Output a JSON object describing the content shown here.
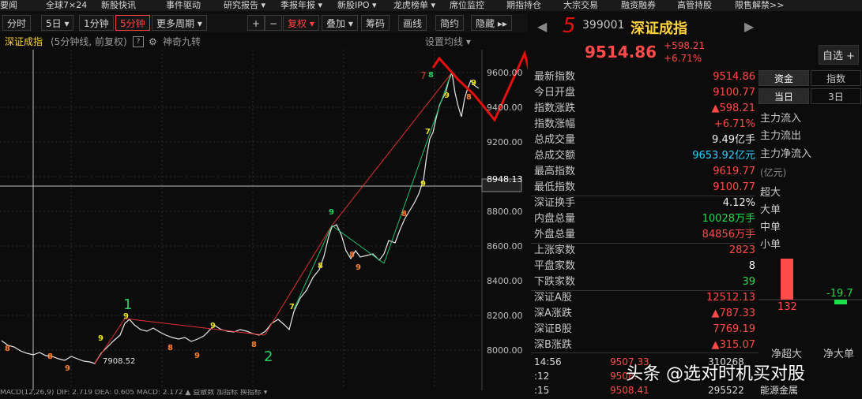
{
  "topbar": [
    "要闻",
    "全球7×24",
    "新股快讯",
    "事件驱动",
    "研究报告 ▾",
    "季报年报 ▾",
    "新股IPO ▾",
    "龙虎榜单 ▾",
    "席位监控",
    "期指持仓",
    "大宗交易",
    "融资融券",
    "高管持股",
    "限售解禁>>"
  ],
  "toolbar": {
    "periods": [
      "分时",
      "5日 ▾",
      "1分钟",
      "5分钟",
      "更多周期 ▾"
    ],
    "plus": "+",
    "minus": "−",
    "fuquan": "复权 ▾",
    "diejia": "叠加 ▾",
    "chouma": "筹码",
    "huaxian": "画线",
    "jianyue": "简约",
    "yincang": "隐藏 ▸▸"
  },
  "subbar": {
    "name": "深证成指",
    "desc": "(5分钟线, 前复权)",
    "question": "?",
    "indicator": "神奇九转",
    "setting": "设置均线 ▾"
  },
  "header": {
    "code": "399001",
    "name": "深证成指",
    "price": "9514.86",
    "change": "+598.21",
    "pct": "+6.71%",
    "zixuan": "自选 +"
  },
  "stats": [
    {
      "k": "最新指数",
      "v": "9514.86",
      "c": "red"
    },
    {
      "k": "今日开盘",
      "v": "9100.77",
      "c": "red"
    },
    {
      "k": "指数涨跌",
      "v": "▲598.21",
      "c": "red"
    },
    {
      "k": "指数涨幅",
      "v": "+6.71%",
      "c": "red"
    },
    {
      "k": "总成交量",
      "v": "9.49亿手",
      "c": "white"
    },
    {
      "k": "总成交额",
      "v": "9653.92亿元",
      "c": "cyan"
    },
    {
      "k": "最高指数",
      "v": "9619.77",
      "c": "red"
    },
    {
      "k": "最低指数",
      "v": "9100.77",
      "c": "red"
    },
    {
      "k": "深证换手",
      "v": "4.12%",
      "c": "white"
    },
    {
      "k": "内盘总量",
      "v": "10028万手",
      "c": "green"
    },
    {
      "k": "外盘总量",
      "v": "84856万手",
      "c": "red"
    },
    {
      "k": "上涨家数",
      "v": "2823",
      "c": "red"
    },
    {
      "k": "平盘家数",
      "v": "8",
      "c": "white"
    },
    {
      "k": "下跌家数",
      "v": "39",
      "c": "green"
    },
    {
      "k": "深证A股",
      "v": "12512.13",
      "c": "red"
    },
    {
      "k": "深A涨跌",
      "v": "▲787.33",
      "c": "red"
    },
    {
      "k": "深证B股",
      "v": "7769.19",
      "c": "red"
    },
    {
      "k": "深B涨跌",
      "v": "▲315.07",
      "c": "red"
    }
  ],
  "flow": {
    "tabs1": [
      "资金",
      "指数"
    ],
    "tabs2": [
      "当日",
      "3日"
    ],
    "items": [
      "主力流入",
      "主力流出",
      "主力净流入"
    ],
    "unit": "(亿元)",
    "sizes": [
      "超大",
      "大单",
      "中单",
      "小单"
    ],
    "bar1": {
      "label": "净超大",
      "value": "132"
    },
    "bar2": {
      "label": "净大单",
      "value": "-19.7"
    },
    "footer": "能源金属"
  },
  "ticks": [
    {
      "time": "14:56",
      "price": "9507.33",
      "vol": "310268"
    },
    {
      "time": ":12",
      "price": "9508.",
      "vol": ""
    },
    {
      "time": ":15",
      "price": "9508.41",
      "vol": "295522"
    }
  ],
  "yaxis": [
    "9600.00",
    "9400.00",
    "9200.00",
    "8948.13",
    "8800.00",
    "8600.00",
    "8400.00",
    "8200.00",
    "8000.00"
  ],
  "annotations": {
    "low": "7908.52",
    "a1": "1",
    "a2": "2",
    "a5": "5",
    "a7": "7"
  },
  "bottom": "MACD(12,26,9)  DIF: 2.719  DEA: 0.605  MACD: 2.172 ▲          益散数  加指标  换指标 ▾",
  "watermark": "头条 @选对时机买对股",
  "chart_data": {
    "type": "line",
    "title": "深证成指",
    "ylim": [
      7908.52,
      9619.77
    ],
    "y_ticks": [
      8000,
      8200,
      8400,
      8600,
      8800,
      9200,
      9400,
      9600
    ],
    "crosshair_y": 8948.13,
    "grid": true
  }
}
